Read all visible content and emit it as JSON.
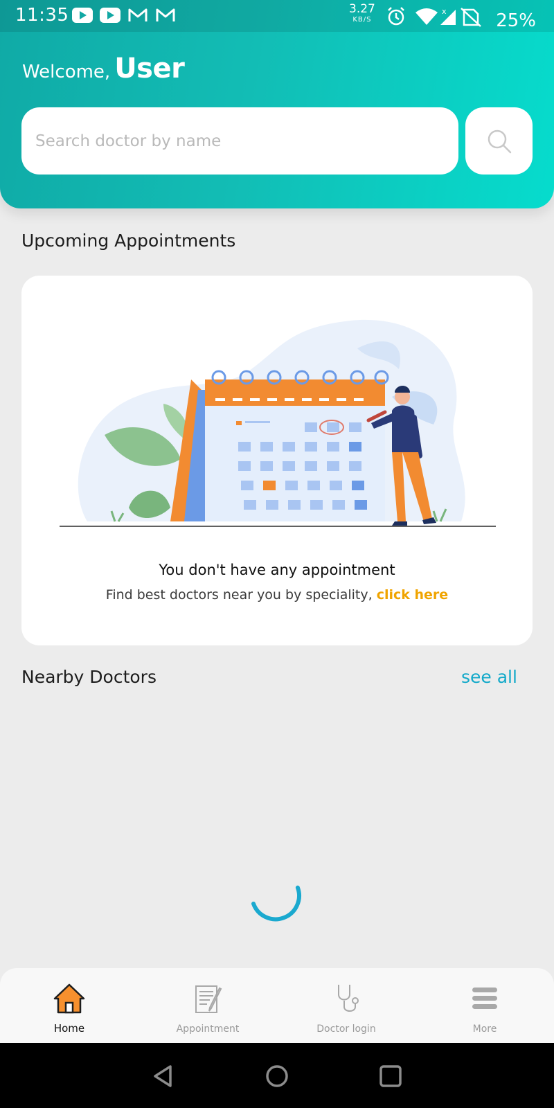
{
  "status_bar": {
    "time": "11:35",
    "net_speed_value": "3.27",
    "net_speed_unit": "KB/S",
    "battery": "25%",
    "icons": [
      "youtube-icon",
      "youtube-icon",
      "gmail-icon",
      "gmail-icon",
      "alarm-icon",
      "wifi-icon",
      "signal-icon",
      "no-sim-icon"
    ]
  },
  "header": {
    "welcome_label": "Welcome,",
    "user_name": "User",
    "search_placeholder": "Search doctor by name",
    "search_icon": "search-icon"
  },
  "upcoming": {
    "title": "Upcoming Appointments",
    "empty_title": "You don't have any appointment",
    "empty_text": "Find best doctors near you by speciality,",
    "empty_link": "click here",
    "illustration": "calendar-illustration"
  },
  "nearby": {
    "title": "Nearby Doctors",
    "see_all": "see all",
    "loading_icon": "spinner-icon"
  },
  "bottom_nav": {
    "items": [
      {
        "label": "Home",
        "icon": "home-icon",
        "active": true
      },
      {
        "label": "Appointment",
        "icon": "clipboard-icon",
        "active": false
      },
      {
        "label": "Doctor login",
        "icon": "stethoscope-icon",
        "active": false
      },
      {
        "label": "More",
        "icon": "menu-icon",
        "active": false
      }
    ]
  },
  "system_nav": [
    "back-icon",
    "home-circle-icon",
    "recents-icon"
  ],
  "colors": {
    "header_gradient_start": "#10aaa6",
    "header_gradient_end": "#06dccd",
    "link_accent": "#f0a400",
    "see_all": "#12a9c9",
    "home_icon": "#f7902e",
    "spinner": "#1aa9cf"
  }
}
